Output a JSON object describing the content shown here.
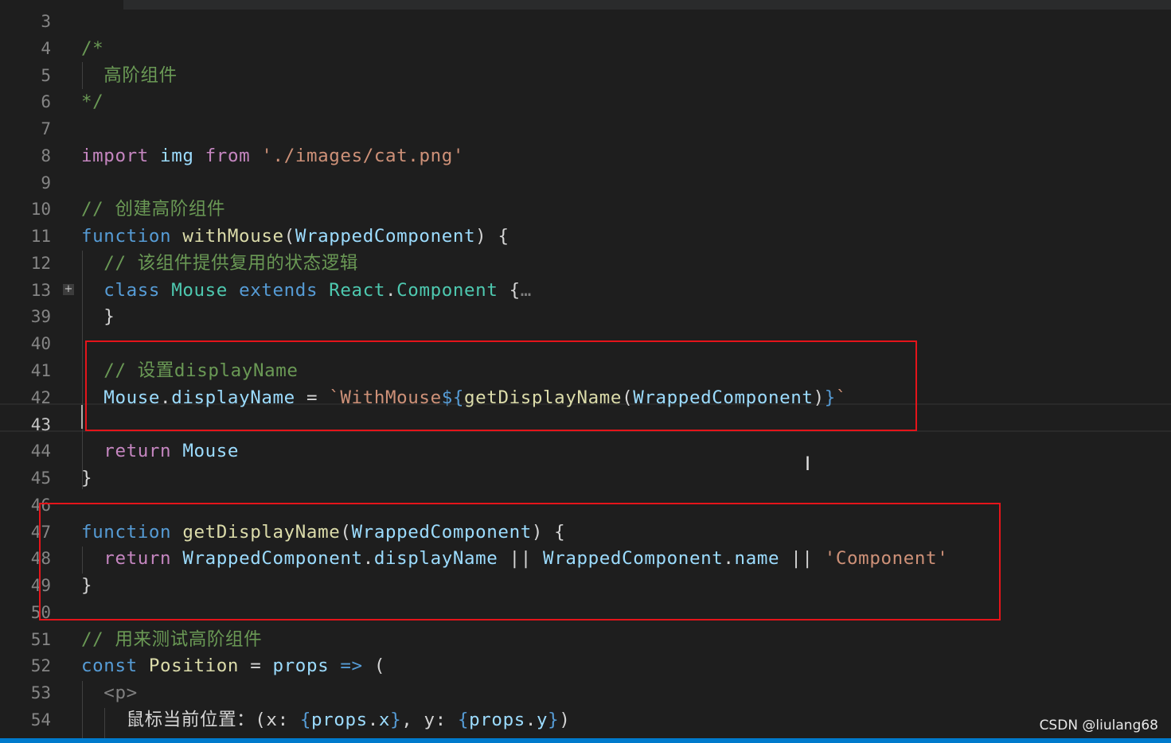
{
  "colors": {
    "background": "#1e1e1e",
    "keyword": "#569cd6",
    "import": "#c586c0",
    "variable": "#9cdcfe",
    "class": "#4ec9b0",
    "function": "#dcdcaa",
    "string": "#ce9178",
    "comment": "#6a9955",
    "highlight_box": "#e5141a",
    "statusbar": "#007acc"
  },
  "watermark": "CSDN @liulang68",
  "active_line": "43",
  "lines": [
    {
      "n": "3",
      "t": []
    },
    {
      "n": "4",
      "t": [
        [
          "/*",
          "cm"
        ]
      ]
    },
    {
      "n": "5",
      "t": [
        [
          "  高阶组件",
          "cm"
        ]
      ]
    },
    {
      "n": "6",
      "t": [
        [
          "*/",
          "cm"
        ]
      ]
    },
    {
      "n": "7",
      "t": []
    },
    {
      "n": "8",
      "t": [
        [
          "import",
          "imp"
        ],
        [
          " ",
          "pl"
        ],
        [
          "img",
          "var"
        ],
        [
          " ",
          "pl"
        ],
        [
          "from",
          "imp"
        ],
        [
          " ",
          "pl"
        ],
        [
          "'./images/cat.png'",
          "str"
        ]
      ]
    },
    {
      "n": "9",
      "t": []
    },
    {
      "n": "10",
      "t": [
        [
          "// 创建高阶组件",
          "cm"
        ]
      ]
    },
    {
      "n": "11",
      "t": [
        [
          "function",
          "kw"
        ],
        [
          " ",
          "pl"
        ],
        [
          "withMouse",
          "fn"
        ],
        [
          "(",
          "pl"
        ],
        [
          "WrappedComponent",
          "var"
        ],
        [
          ") {",
          "pl"
        ]
      ]
    },
    {
      "n": "12",
      "t": [
        [
          "  // 该组件提供复用的状态逻辑",
          "cm"
        ]
      ]
    },
    {
      "n": "13",
      "t": [
        [
          "  ",
          "pl"
        ],
        [
          "class",
          "kw"
        ],
        [
          " ",
          "pl"
        ],
        [
          "Mouse",
          "cls"
        ],
        [
          " ",
          "pl"
        ],
        [
          "extends",
          "kw"
        ],
        [
          " ",
          "pl"
        ],
        [
          "React",
          "cls"
        ],
        [
          ".",
          "pl"
        ],
        [
          "Component",
          "cls"
        ],
        [
          " {",
          "pl"
        ],
        [
          "…",
          "fold"
        ]
      ]
    },
    {
      "n": "39",
      "t": [
        [
          "  }",
          "pl"
        ]
      ]
    },
    {
      "n": "40",
      "t": []
    },
    {
      "n": "41",
      "t": [
        [
          "  // 设置displayName",
          "cm"
        ]
      ]
    },
    {
      "n": "42",
      "t": [
        [
          "  ",
          "pl"
        ],
        [
          "Mouse",
          "var"
        ],
        [
          ".",
          "pl"
        ],
        [
          "displayName",
          "var"
        ],
        [
          " = ",
          "pl"
        ],
        [
          "`WithMouse",
          "str"
        ],
        [
          "${",
          "kw"
        ],
        [
          "getDisplayName",
          "fn"
        ],
        [
          "(",
          "pl"
        ],
        [
          "WrappedComponent",
          "var"
        ],
        [
          ")",
          "pl"
        ],
        [
          "}",
          "kw"
        ],
        [
          "`",
          "str"
        ]
      ]
    },
    {
      "n": "43",
      "t": []
    },
    {
      "n": "44",
      "t": [
        [
          "  ",
          "pl"
        ],
        [
          "return",
          "imp"
        ],
        [
          " ",
          "pl"
        ],
        [
          "Mouse",
          "var"
        ]
      ]
    },
    {
      "n": "45",
      "t": [
        [
          "}",
          "pl"
        ]
      ]
    },
    {
      "n": "46",
      "t": []
    },
    {
      "n": "47",
      "t": [
        [
          "function",
          "kw"
        ],
        [
          " ",
          "pl"
        ],
        [
          "getDisplayName",
          "fn"
        ],
        [
          "(",
          "pl"
        ],
        [
          "WrappedComponent",
          "var"
        ],
        [
          ") {",
          "pl"
        ]
      ]
    },
    {
      "n": "48",
      "t": [
        [
          "  ",
          "pl"
        ],
        [
          "return",
          "imp"
        ],
        [
          " ",
          "pl"
        ],
        [
          "WrappedComponent",
          "var"
        ],
        [
          ".",
          "pl"
        ],
        [
          "displayName",
          "var"
        ],
        [
          " || ",
          "pl"
        ],
        [
          "WrappedComponent",
          "var"
        ],
        [
          ".",
          "pl"
        ],
        [
          "name",
          "var"
        ],
        [
          " || ",
          "pl"
        ],
        [
          "'Component'",
          "str"
        ]
      ]
    },
    {
      "n": "49",
      "t": [
        [
          "}",
          "pl"
        ]
      ]
    },
    {
      "n": "50",
      "t": []
    },
    {
      "n": "51",
      "t": [
        [
          "// 用来测试高阶组件",
          "cm"
        ]
      ]
    },
    {
      "n": "52",
      "t": [
        [
          "const",
          "kw"
        ],
        [
          " ",
          "pl"
        ],
        [
          "Position",
          "fn"
        ],
        [
          " = ",
          "pl"
        ],
        [
          "props",
          "var"
        ],
        [
          " ",
          "pl"
        ],
        [
          "=>",
          "kw"
        ],
        [
          " (",
          "pl"
        ]
      ]
    },
    {
      "n": "53",
      "t": [
        [
          "  ",
          "pl"
        ],
        [
          "<p>",
          "fold"
        ]
      ]
    },
    {
      "n": "54",
      "t": [
        [
          "    鼠标当前位置：(x: ",
          "pl"
        ],
        [
          "{",
          "kw"
        ],
        [
          "props",
          "var"
        ],
        [
          ".",
          "pl"
        ],
        [
          "x",
          "var"
        ],
        [
          "}",
          "kw"
        ],
        [
          ", y: ",
          "pl"
        ],
        [
          "{",
          "kw"
        ],
        [
          "props",
          "var"
        ],
        [
          ".",
          "pl"
        ],
        [
          "y",
          "var"
        ],
        [
          "}",
          "kw"
        ],
        [
          ")",
          "pl"
        ]
      ]
    }
  ]
}
